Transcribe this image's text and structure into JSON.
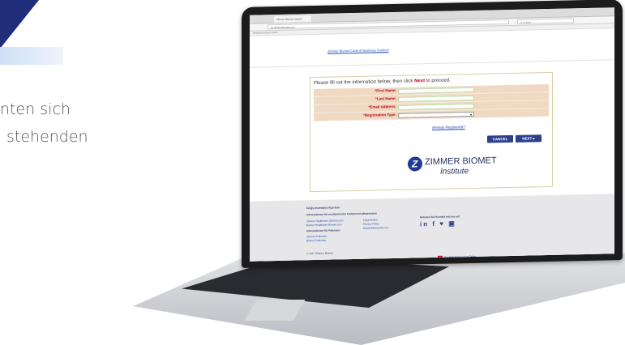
{
  "side": {
    "line1": "nten sich",
    "line2": "stehenden"
  },
  "browser": {
    "tab_label": "Zimmer Biomet Institute",
    "address": "zb.zimmerbiomet.com",
    "search_placeholder": "Q Suchen",
    "bookmarks": "Meistbesucht  Erste Schritte"
  },
  "page": {
    "code_link": "Zimmer Biomet Code of Business Conduct",
    "form": {
      "heading_pre": "Please fill out the information below, then click ",
      "heading_next": "Next",
      "heading_post": " to proceed.",
      "fields": [
        {
          "label": "*First Name:"
        },
        {
          "label": "*Last Name:"
        },
        {
          "label": "*Email Address:"
        },
        {
          "label": "*Registration Type:",
          "select": "▾"
        }
      ],
      "already": "Already Registered?",
      "cancel": "CANCEL",
      "next": "NEXT ▸"
    },
    "logo": {
      "mark": "Z",
      "name": "ZIMMER BIOMET",
      "sub": "Institute"
    },
    "footer": {
      "nav": "FAQs   Investors   Karriere",
      "col1_head": "Informationen für medizinisches Fachpersonal",
      "col1_links": [
        "Zimmer Healthcare Zimmer.com",
        "Biomet Healthcare Biomet.com"
      ],
      "col1b_head": "Informationen für Patienten",
      "col1b_links": [
        "Zimmer Patienten",
        "Biomet Patienten"
      ],
      "col2_head": "Impressum",
      "col2_links": [
        "Legal Notice",
        "Privacy Policy",
        "DataInstituteLinks.org"
      ],
      "col3_head": "Nehmen Sie Kontakt mit uns auf",
      "social": "in f ♥ ▣",
      "copyright": "© 2017 Zimmer Biomet",
      "lang": "Deutsch   Datenschutz   Teilen",
      "flag_color": "#c8102e"
    }
  }
}
